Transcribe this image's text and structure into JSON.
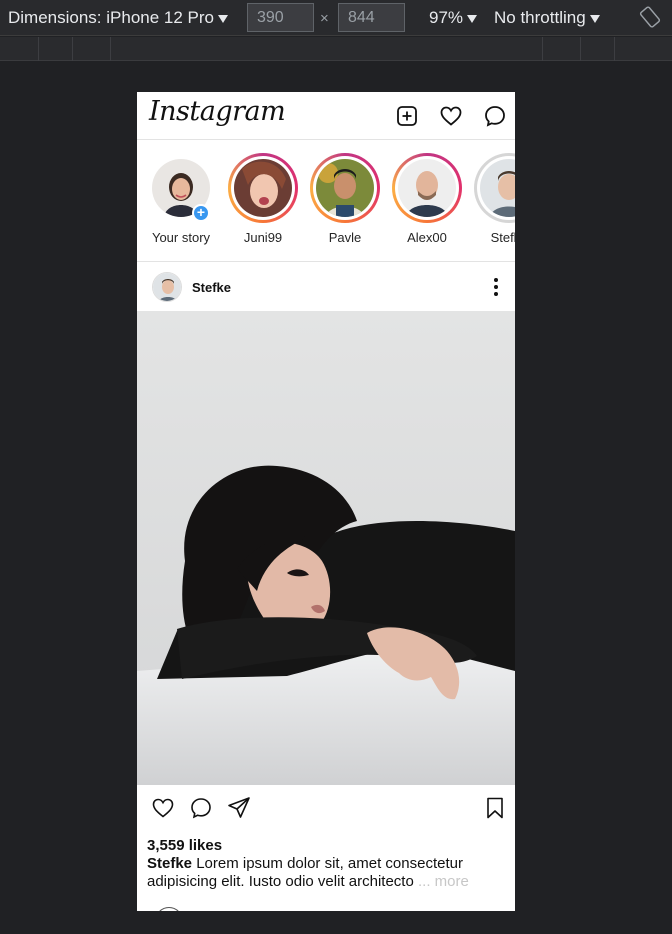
{
  "devtools": {
    "dimensions_label": "Dimensions: iPhone 12 Pro",
    "width_value": "390",
    "height_value": "844",
    "times": "×",
    "zoom": "97%",
    "throttling": "No throttling"
  },
  "app": {
    "logo": "Instagram"
  },
  "stories": [
    {
      "label": "Your story"
    },
    {
      "label": "Juni99"
    },
    {
      "label": "Pavle"
    },
    {
      "label": "Alex00"
    },
    {
      "label": "Stefke"
    }
  ],
  "post": {
    "username": "Stefke",
    "likes": "3,559 likes",
    "caption_user": "Stefke",
    "caption_text": " Lorem ipsum dolor sit, amet consectetur adipisicing elit. Iusto odio velit architecto",
    "more": " ... more"
  },
  "colors": {
    "story_ring": "#e1306c",
    "add_badge": "#3897f0",
    "devtools_bg": "#202124"
  }
}
